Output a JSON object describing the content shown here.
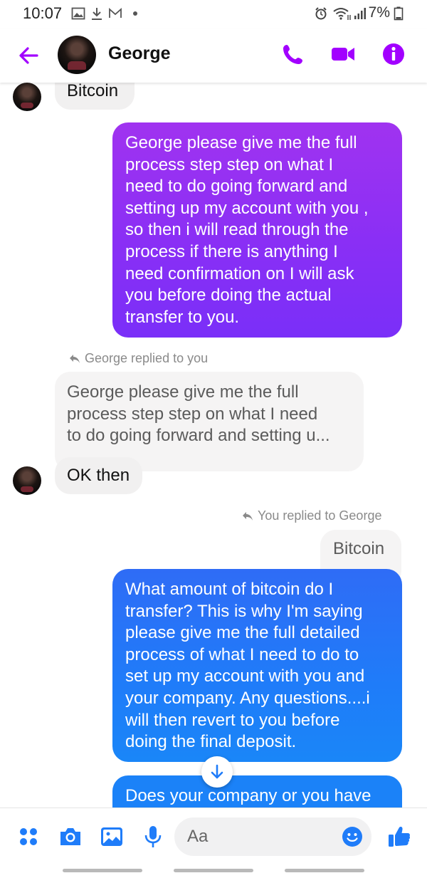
{
  "status_bar": {
    "time": "10:07",
    "battery": "7%",
    "icons": [
      "gallery-icon",
      "download-icon",
      "gmail-icon",
      "dot-icon",
      "alarm-icon",
      "wifi-icon",
      "signal-icon",
      "battery-icon"
    ]
  },
  "header": {
    "contact_name": "George",
    "actions": [
      "phone-icon",
      "video-icon",
      "info-icon"
    ],
    "accent_color": "#a200ff"
  },
  "messages": [
    {
      "from": "contact",
      "text": "Bitcoin"
    },
    {
      "from": "me",
      "text": "George please give me the full process step step on what I need to do going forward and setting up my account with you , so then i will read through the process if there is anything I need confirmation on I will ask you before doing the actual transfer to you."
    },
    {
      "from": "contact",
      "reply_meta": "George replied to you",
      "quoted_text": "George please give me the full process step step on what I need to do going forward and setting u...",
      "text": "OK then"
    },
    {
      "from": "me",
      "reply_meta": "You replied to George",
      "quoted_text": "Bitcoin",
      "text": "What amount of bitcoin do I transfer? This is why I'm saying please give me the full detailed process of what I need to do to set up my account with you and your company. Any questions....i will then revert to you before doing the final deposit."
    },
    {
      "from": "me",
      "text": "Does your company or you have"
    }
  ],
  "message_lines": {
    "m2": [
      "George please give me the full",
      "process step step on what I",
      "need to do going forward and",
      "setting up my account with you ,",
      "so then i will read through the",
      "process if there is anything I",
      "need confirmation on I will ask",
      "you before doing the actual",
      "transfer to you."
    ],
    "q1": [
      "George please give me the full",
      "process step step on what I need",
      "to do going forward and setting u..."
    ],
    "m4": [
      "What amount of bitcoin do I",
      "transfer? This is why I'm saying",
      "please give me the full detailed",
      "process of what I need to do to",
      "set up my account with you and",
      "your company. Any questions....i",
      "will then revert to you before",
      "doing the final deposit."
    ]
  },
  "composer": {
    "placeholder": "Aa",
    "icons": [
      "menu-dots-icon",
      "camera-icon",
      "image-icon",
      "microphone-icon",
      "emoji-icon",
      "thumbs-up-icon"
    ]
  },
  "colors": {
    "outgoing_purple": "#8a2ff5",
    "outgoing_blue": "#1f7cf9",
    "incoming_bg": "#f1f0f0",
    "icon_accent": "#a200ff",
    "composer_icon": "#1f7cf9"
  }
}
